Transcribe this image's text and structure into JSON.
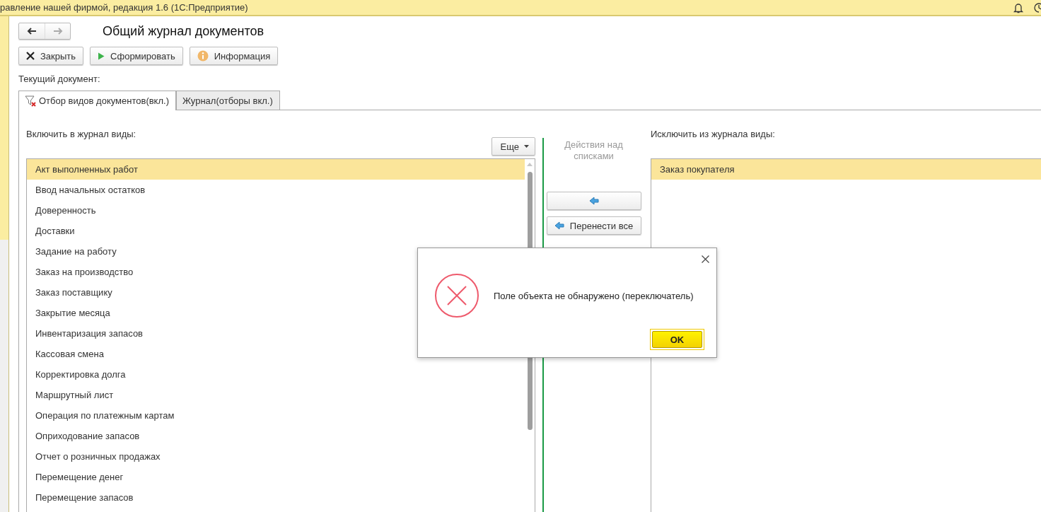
{
  "window": {
    "title": "равление нашей фирмой, редакция 1.6  (1С:Предприятие)"
  },
  "form": {
    "title": "Общий журнал документов",
    "toolbar": [
      {
        "kind": "close",
        "label": "Закрыть"
      },
      {
        "kind": "run",
        "label": "Сформировать"
      },
      {
        "kind": "info",
        "label": "Информация"
      }
    ],
    "current_document_label": "Текущий документ:",
    "tabs": [
      {
        "label": "Отбор видов документов(вкл.)",
        "selected": true,
        "filter_icon": true
      },
      {
        "label": "Журнал(отборы вкл.)",
        "selected": false,
        "filter_icon": false
      }
    ],
    "include": {
      "label": "Включить в журнал виды:",
      "more_button": "Еще",
      "rows": [
        {
          "text": "Акт выполненных работ",
          "selected": true
        },
        {
          "text": "Ввод начальных остатков",
          "selected": false
        },
        {
          "text": "Доверенность",
          "selected": false
        },
        {
          "text": "Доставки",
          "selected": false
        },
        {
          "text": "Задание на работу",
          "selected": false
        },
        {
          "text": "Заказ на производство",
          "selected": false
        },
        {
          "text": "Заказ поставщику",
          "selected": false
        },
        {
          "text": "Закрытие месяца",
          "selected": false
        },
        {
          "text": "Инвентаризация запасов",
          "selected": false
        },
        {
          "text": "Кассовая смена",
          "selected": false
        },
        {
          "text": "Корректировка долга",
          "selected": false
        },
        {
          "text": "Маршрутный лист",
          "selected": false
        },
        {
          "text": "Операция по платежным картам",
          "selected": false
        },
        {
          "text": "Оприходование запасов",
          "selected": false
        },
        {
          "text": "Отчет о розничных продажах",
          "selected": false
        },
        {
          "text": "Перемещение денег",
          "selected": false
        },
        {
          "text": "Перемещение запасов",
          "selected": false
        }
      ]
    },
    "actions": {
      "caption": "Действия над списками",
      "buttons": [
        {
          "kind": "single"
        },
        {
          "kind": "all",
          "label": "Перенести все"
        }
      ]
    },
    "exclude": {
      "label": "Исключить из журнала виды:",
      "rows": [
        {
          "text": "Заказ покупателя",
          "selected": true
        }
      ]
    }
  },
  "dialog": {
    "message": "Поле объекта не обнаружено (переключатель)",
    "button": "OK"
  }
}
